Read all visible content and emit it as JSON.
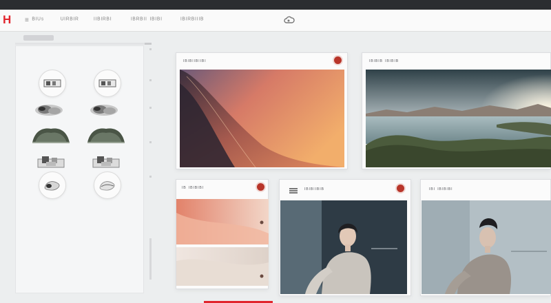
{
  "app": {
    "logo_text": "H"
  },
  "nav": {
    "items": [
      {
        "label": "≡ ᴮᴵᵁˢ"
      },
      {
        "label": "ᵁᴵᴿᴮᴵᴿ"
      },
      {
        "label": "ᴵᴵᴮᴵᴿᴮᴵ"
      },
      {
        "label": "ᴵᴮᴿᴮᴵᴵ ᴵᴮᴵᴮᴵ"
      },
      {
        "label": "ᴵᴮᴵᴿᴮᴵᴵᴵᴮ"
      }
    ]
  },
  "sidebar": {
    "header_label": "",
    "tools": [
      {
        "icon": "device-frame-icon"
      },
      {
        "icon": "device-frame-icon"
      },
      {
        "icon": "smoke-brush-icon"
      },
      {
        "icon": "smoke-brush-icon"
      },
      {
        "icon": "foliage-brush-icon"
      },
      {
        "icon": "foliage-brush-icon"
      },
      {
        "icon": "block-shapes-icon"
      },
      {
        "icon": "block-shapes-icon"
      },
      {
        "icon": "sculpt-blob-icon"
      },
      {
        "icon": "sculpt-blob-icon"
      }
    ]
  },
  "cards": {
    "desert": {
      "title": "ᴵᴮᴵᴮᴵᴵᴮᴵᴵᴮᴵ"
    },
    "lake": {
      "title": "ᴵᴮᴵᴮᴵᴮ ᴵᴮᴵᴮᴵᴮ"
    },
    "gradient": {
      "title": "ᴵᴮ ᴵᴮᴵᴮᴵᴮᴵ"
    },
    "portrait": {
      "title": "ᴵᴮᴵᴮᴵᴵᴮᴵᴮ"
    },
    "portrait2": {
      "title": "ᴵᴮᴵ ᴵᴮᴵᴮᴵᴮᴵ"
    }
  },
  "colors": {
    "accent": "#e1252d",
    "card_dot": "#b8352a",
    "background": "#eceeef"
  }
}
